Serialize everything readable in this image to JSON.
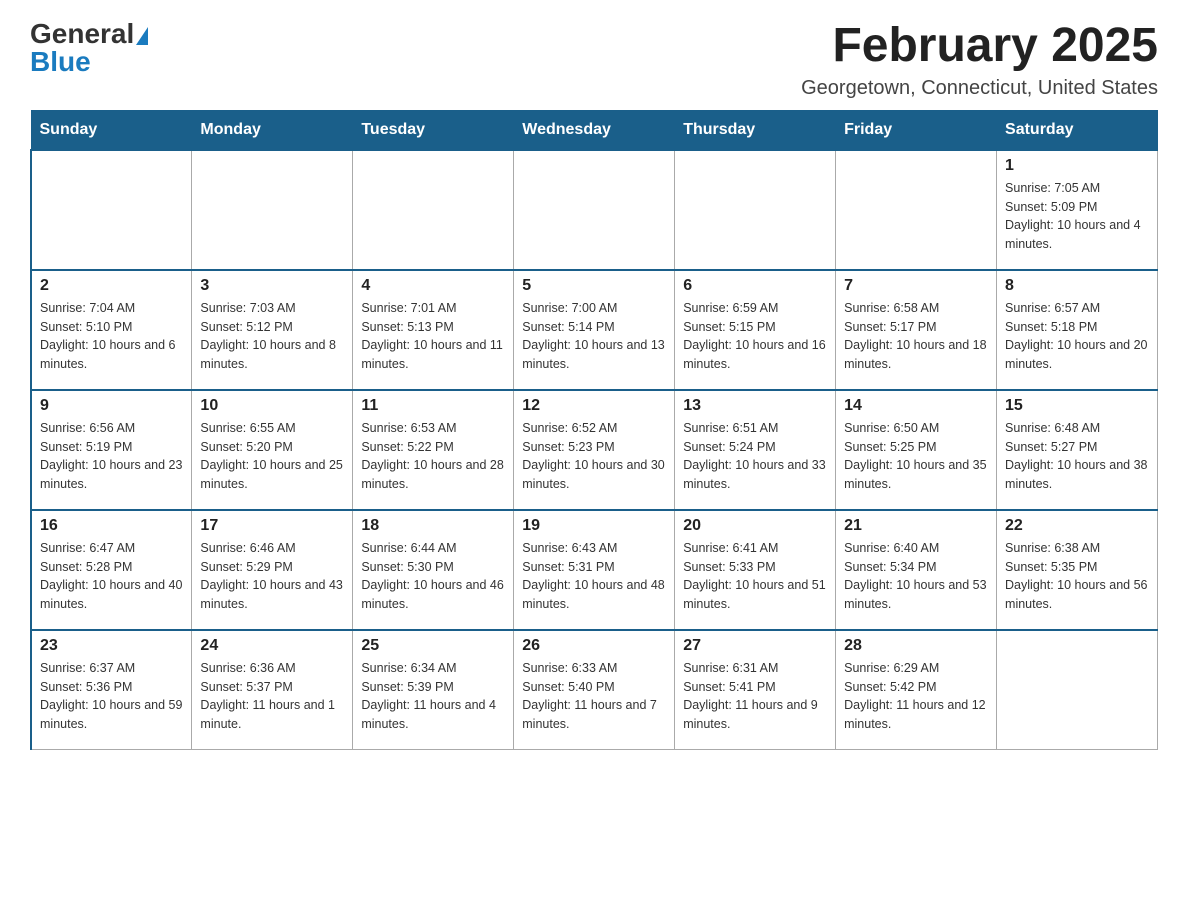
{
  "logo": {
    "general": "General",
    "blue": "Blue"
  },
  "header": {
    "title": "February 2025",
    "location": "Georgetown, Connecticut, United States"
  },
  "weekdays": [
    "Sunday",
    "Monday",
    "Tuesday",
    "Wednesday",
    "Thursday",
    "Friday",
    "Saturday"
  ],
  "weeks": [
    [
      {
        "day": "",
        "info": ""
      },
      {
        "day": "",
        "info": ""
      },
      {
        "day": "",
        "info": ""
      },
      {
        "day": "",
        "info": ""
      },
      {
        "day": "",
        "info": ""
      },
      {
        "day": "",
        "info": ""
      },
      {
        "day": "1",
        "info": "Sunrise: 7:05 AM\nSunset: 5:09 PM\nDaylight: 10 hours and 4 minutes."
      }
    ],
    [
      {
        "day": "2",
        "info": "Sunrise: 7:04 AM\nSunset: 5:10 PM\nDaylight: 10 hours and 6 minutes."
      },
      {
        "day": "3",
        "info": "Sunrise: 7:03 AM\nSunset: 5:12 PM\nDaylight: 10 hours and 8 minutes."
      },
      {
        "day": "4",
        "info": "Sunrise: 7:01 AM\nSunset: 5:13 PM\nDaylight: 10 hours and 11 minutes."
      },
      {
        "day": "5",
        "info": "Sunrise: 7:00 AM\nSunset: 5:14 PM\nDaylight: 10 hours and 13 minutes."
      },
      {
        "day": "6",
        "info": "Sunrise: 6:59 AM\nSunset: 5:15 PM\nDaylight: 10 hours and 16 minutes."
      },
      {
        "day": "7",
        "info": "Sunrise: 6:58 AM\nSunset: 5:17 PM\nDaylight: 10 hours and 18 minutes."
      },
      {
        "day": "8",
        "info": "Sunrise: 6:57 AM\nSunset: 5:18 PM\nDaylight: 10 hours and 20 minutes."
      }
    ],
    [
      {
        "day": "9",
        "info": "Sunrise: 6:56 AM\nSunset: 5:19 PM\nDaylight: 10 hours and 23 minutes."
      },
      {
        "day": "10",
        "info": "Sunrise: 6:55 AM\nSunset: 5:20 PM\nDaylight: 10 hours and 25 minutes."
      },
      {
        "day": "11",
        "info": "Sunrise: 6:53 AM\nSunset: 5:22 PM\nDaylight: 10 hours and 28 minutes."
      },
      {
        "day": "12",
        "info": "Sunrise: 6:52 AM\nSunset: 5:23 PM\nDaylight: 10 hours and 30 minutes."
      },
      {
        "day": "13",
        "info": "Sunrise: 6:51 AM\nSunset: 5:24 PM\nDaylight: 10 hours and 33 minutes."
      },
      {
        "day": "14",
        "info": "Sunrise: 6:50 AM\nSunset: 5:25 PM\nDaylight: 10 hours and 35 minutes."
      },
      {
        "day": "15",
        "info": "Sunrise: 6:48 AM\nSunset: 5:27 PM\nDaylight: 10 hours and 38 minutes."
      }
    ],
    [
      {
        "day": "16",
        "info": "Sunrise: 6:47 AM\nSunset: 5:28 PM\nDaylight: 10 hours and 40 minutes."
      },
      {
        "day": "17",
        "info": "Sunrise: 6:46 AM\nSunset: 5:29 PM\nDaylight: 10 hours and 43 minutes."
      },
      {
        "day": "18",
        "info": "Sunrise: 6:44 AM\nSunset: 5:30 PM\nDaylight: 10 hours and 46 minutes."
      },
      {
        "day": "19",
        "info": "Sunrise: 6:43 AM\nSunset: 5:31 PM\nDaylight: 10 hours and 48 minutes."
      },
      {
        "day": "20",
        "info": "Sunrise: 6:41 AM\nSunset: 5:33 PM\nDaylight: 10 hours and 51 minutes."
      },
      {
        "day": "21",
        "info": "Sunrise: 6:40 AM\nSunset: 5:34 PM\nDaylight: 10 hours and 53 minutes."
      },
      {
        "day": "22",
        "info": "Sunrise: 6:38 AM\nSunset: 5:35 PM\nDaylight: 10 hours and 56 minutes."
      }
    ],
    [
      {
        "day": "23",
        "info": "Sunrise: 6:37 AM\nSunset: 5:36 PM\nDaylight: 10 hours and 59 minutes."
      },
      {
        "day": "24",
        "info": "Sunrise: 6:36 AM\nSunset: 5:37 PM\nDaylight: 11 hours and 1 minute."
      },
      {
        "day": "25",
        "info": "Sunrise: 6:34 AM\nSunset: 5:39 PM\nDaylight: 11 hours and 4 minutes."
      },
      {
        "day": "26",
        "info": "Sunrise: 6:33 AM\nSunset: 5:40 PM\nDaylight: 11 hours and 7 minutes."
      },
      {
        "day": "27",
        "info": "Sunrise: 6:31 AM\nSunset: 5:41 PM\nDaylight: 11 hours and 9 minutes."
      },
      {
        "day": "28",
        "info": "Sunrise: 6:29 AM\nSunset: 5:42 PM\nDaylight: 11 hours and 12 minutes."
      },
      {
        "day": "",
        "info": ""
      }
    ]
  ]
}
